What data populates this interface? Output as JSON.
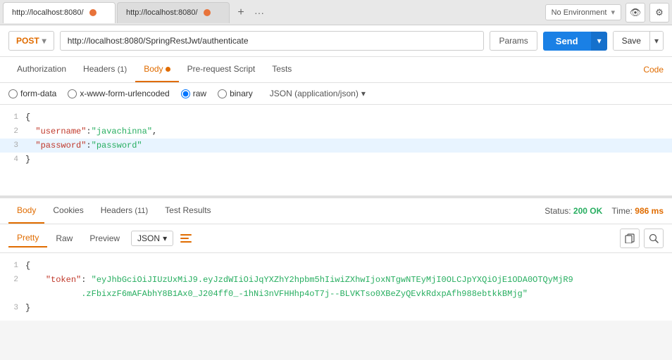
{
  "tabs": [
    {
      "id": "tab1",
      "label": "http://localhost:8080/",
      "active": true
    },
    {
      "id": "tab2",
      "label": "http://localhost:8080/",
      "active": false
    }
  ],
  "toolbar": {
    "plus_label": "+",
    "more_label": "···",
    "env_label": "No Environment",
    "eye_icon": "👁",
    "gear_icon": "⚙"
  },
  "request": {
    "method": "POST",
    "url": "http://localhost:8080/SpringRestJwt/authenticate",
    "params_label": "Params",
    "send_label": "Send",
    "save_label": "Save"
  },
  "req_tabs": [
    {
      "id": "authorization",
      "label": "Authorization",
      "active": false,
      "badge": null,
      "dot": false
    },
    {
      "id": "headers",
      "label": "Headers",
      "active": false,
      "badge": "(1)",
      "dot": false
    },
    {
      "id": "body",
      "label": "Body",
      "active": true,
      "badge": null,
      "dot": true
    },
    {
      "id": "prerequest",
      "label": "Pre-request Script",
      "active": false,
      "badge": null,
      "dot": false
    },
    {
      "id": "tests",
      "label": "Tests",
      "active": false,
      "badge": null,
      "dot": false
    }
  ],
  "code_link": "Code",
  "body_options": [
    {
      "id": "form-data",
      "label": "form-data",
      "checked": false
    },
    {
      "id": "urlencoded",
      "label": "x-www-form-urlencoded",
      "checked": false
    },
    {
      "id": "raw",
      "label": "raw",
      "checked": true
    },
    {
      "id": "binary",
      "label": "binary",
      "checked": false
    }
  ],
  "json_format": "JSON (application/json)",
  "request_body": {
    "lines": [
      {
        "num": 1,
        "content": "{"
      },
      {
        "num": 2,
        "content": "  \"username\":\"javachinna\",",
        "key": "username",
        "val": "javachinna"
      },
      {
        "num": 3,
        "content": "  \"password\":\"password\"",
        "key": "password",
        "val": "password",
        "highlighted": true
      },
      {
        "num": 4,
        "content": "}"
      }
    ]
  },
  "response": {
    "status": "Status:",
    "status_code": "200 OK",
    "time_label": "Time:",
    "time_value": "986 ms",
    "tabs": [
      {
        "id": "body",
        "label": "Body",
        "active": true
      },
      {
        "id": "cookies",
        "label": "Cookies",
        "active": false
      },
      {
        "id": "headers",
        "label": "Headers",
        "badge": "(11)",
        "active": false
      },
      {
        "id": "test-results",
        "label": "Test Results",
        "active": false
      }
    ],
    "format_tabs": [
      {
        "id": "pretty",
        "label": "Pretty",
        "active": true
      },
      {
        "id": "raw",
        "label": "Raw",
        "active": false
      },
      {
        "id": "preview",
        "label": "Preview",
        "active": false
      }
    ],
    "format_select": "JSON",
    "lines": [
      {
        "num": 1,
        "content": "{"
      },
      {
        "num": 2,
        "content": "    \"token\": \"eyJhbGciOiJIUzUxMiJ9.eyJzdWIiOiJqYXZhY2hpbm5hIiwiZXhwIjoxNTgwNTEyMjI0OLCJpYXQiOjE1ODA0OTQyMjR9.zFbixzF6mAFAbhY8B1Ax0_J204ff0_-1hNi3nVFHHhp4oT7j--BLVKTso0XBeZyQEvkRdxpAfh988ebtkkBMjg\""
      },
      {
        "num": 3,
        "content": "}"
      }
    ]
  }
}
